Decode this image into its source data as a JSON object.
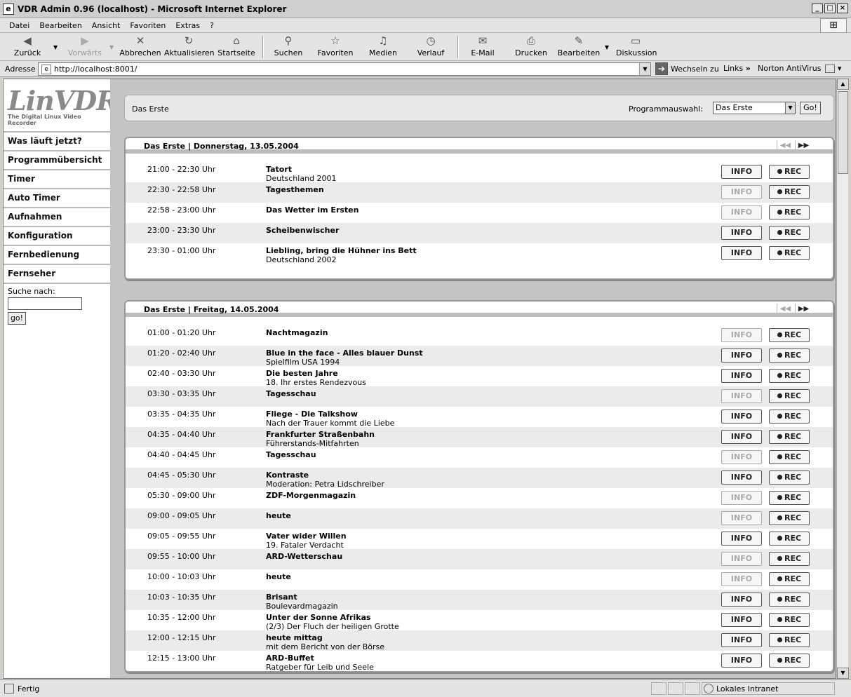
{
  "window": {
    "title": "VDR Admin 0.96 (localhost) - Microsoft Internet Explorer"
  },
  "menu": [
    "Datei",
    "Bearbeiten",
    "Ansicht",
    "Favoriten",
    "Extras",
    "?"
  ],
  "toolbar": {
    "back": "Zurück",
    "forward": "Vorwärts",
    "stop": "Abbrechen",
    "refresh": "Aktualisieren",
    "home": "Startseite",
    "search": "Suchen",
    "favorites": "Favoriten",
    "media": "Medien",
    "history": "Verlauf",
    "mail": "E-Mail",
    "print": "Drucken",
    "edit": "Bearbeiten",
    "discuss": "Diskussion"
  },
  "address": {
    "label": "Adresse",
    "url": "http://localhost:8001/",
    "go": "Wechseln zu",
    "links": "Links",
    "norton": "Norton AntiVirus"
  },
  "sidebar": {
    "logo_text": "LinVDR",
    "logo_sub": "The Digital Linux Video Recorder",
    "items": [
      "Was läuft jetzt?",
      "Programmübersicht",
      "Timer",
      "Auto Timer",
      "Aufnahmen",
      "Konfiguration",
      "Fernbedienung",
      "Fernseher"
    ],
    "search_label": "Suche nach:",
    "search_button": "go!"
  },
  "channel_header": {
    "name": "Das Erste",
    "select_label": "Programmauswahl:",
    "selected": "Das Erste",
    "go": "Go!"
  },
  "buttons": {
    "info": "INFO",
    "rec": "REC"
  },
  "days": [
    {
      "title": "Das Erste | Donnerstag, 13.05.2004",
      "rows": [
        {
          "time": "21:00 - 22:30 Uhr",
          "title": "Tatort",
          "subtitle": "Deutschland 2001",
          "info_enabled": true
        },
        {
          "time": "22:30 - 22:58 Uhr",
          "title": "Tagesthemen",
          "subtitle": "",
          "info_enabled": false
        },
        {
          "time": "22:58 - 23:00 Uhr",
          "title": "Das Wetter im Ersten",
          "subtitle": "",
          "info_enabled": false
        },
        {
          "time": "23:00 - 23:30 Uhr",
          "title": "Scheibenwischer",
          "subtitle": "",
          "info_enabled": true
        },
        {
          "time": "23:30 - 01:00 Uhr",
          "title": "Liebling, bring die Hühner ins Bett",
          "subtitle": "Deutschland 2002",
          "info_enabled": true
        }
      ]
    },
    {
      "title": "Das Erste | Freitag, 14.05.2004",
      "rows": [
        {
          "time": "01:00 - 01:20 Uhr",
          "title": "Nachtmagazin",
          "subtitle": "",
          "info_enabled": false
        },
        {
          "time": "01:20 - 02:40 Uhr",
          "title": "Blue in the face - Alles blauer Dunst",
          "subtitle": "Spielfilm USA 1994",
          "info_enabled": true
        },
        {
          "time": "02:40 - 03:30 Uhr",
          "title": "Die besten Jahre",
          "subtitle": "18. Ihr erstes Rendezvous",
          "info_enabled": true
        },
        {
          "time": "03:30 - 03:35 Uhr",
          "title": "Tagesschau",
          "subtitle": "",
          "info_enabled": false
        },
        {
          "time": "03:35 - 04:35 Uhr",
          "title": "Fliege - Die Talkshow",
          "subtitle": "Nach der Trauer kommt die Liebe",
          "info_enabled": true
        },
        {
          "time": "04:35 - 04:40 Uhr",
          "title": "Frankfurter Straßenbahn",
          "subtitle": "Führerstands-Mitfahrten",
          "info_enabled": true
        },
        {
          "time": "04:40 - 04:45 Uhr",
          "title": "Tagesschau",
          "subtitle": "",
          "info_enabled": false
        },
        {
          "time": "04:45 - 05:30 Uhr",
          "title": "Kontraste",
          "subtitle": "Moderation: Petra Lidschreiber",
          "info_enabled": true
        },
        {
          "time": "05:30 - 09:00 Uhr",
          "title": "ZDF-Morgenmagazin",
          "subtitle": "",
          "info_enabled": false
        },
        {
          "time": "09:00 - 09:05 Uhr",
          "title": "heute",
          "subtitle": "",
          "info_enabled": false
        },
        {
          "time": "09:05 - 09:55 Uhr",
          "title": "Vater wider Willen",
          "subtitle": "19. Fataler Verdacht",
          "info_enabled": true
        },
        {
          "time": "09:55 - 10:00 Uhr",
          "title": "ARD-Wetterschau",
          "subtitle": "",
          "info_enabled": false
        },
        {
          "time": "10:00 - 10:03 Uhr",
          "title": "heute",
          "subtitle": "",
          "info_enabled": false
        },
        {
          "time": "10:03 - 10:35 Uhr",
          "title": "Brisant",
          "subtitle": "Boulevardmagazin",
          "info_enabled": true
        },
        {
          "time": "10:35 - 12:00 Uhr",
          "title": "Unter der Sonne Afrikas",
          "subtitle": "(2/3) Der Fluch der heiligen Grotte",
          "info_enabled": true
        },
        {
          "time": "12:00 - 12:15 Uhr",
          "title": "heute mittag",
          "subtitle": "mit dem Bericht von der Börse",
          "info_enabled": true
        },
        {
          "time": "12:15 - 13:00 Uhr",
          "title": "ARD-Buffet",
          "subtitle": "Ratgeber für Leib und Seele",
          "info_enabled": true
        }
      ]
    }
  ],
  "status": {
    "text": "Fertig",
    "zone": "Lokales Intranet"
  }
}
